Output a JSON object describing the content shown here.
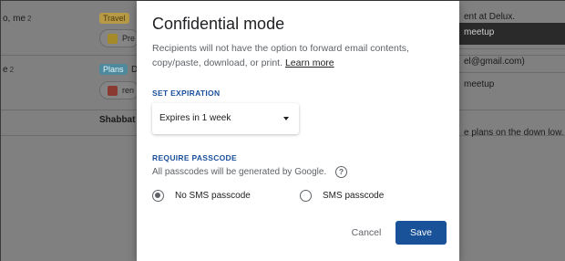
{
  "inbox": {
    "rows": [
      {
        "sender": "o, me",
        "count": "2",
        "label": "Travel",
        "attachment": "Pre"
      },
      {
        "sender": "e",
        "count": "2",
        "label": "Plans",
        "subject": "D",
        "attachment": "ren"
      },
      {
        "subject": "Shabbat"
      }
    ],
    "right_fragments": [
      "ent at Delux.",
      "meetup",
      "el@gmail.com)",
      "meetup",
      "e plans on the down low. Co"
    ]
  },
  "modal": {
    "title": "Confidential mode",
    "description": "Recipients will not have the option to forward email contents, copy/paste, download, or print.",
    "learn_more": "Learn more",
    "expiration": {
      "label": "SET EXPIRATION",
      "selected": "Expires in 1 week"
    },
    "passcode": {
      "label": "REQUIRE PASSCODE",
      "note": "All passcodes will be generated by Google.",
      "options": [
        {
          "label": "No SMS passcode",
          "checked": true
        },
        {
          "label": "SMS passcode",
          "checked": false
        }
      ]
    },
    "cancel_label": "Cancel",
    "save_label": "Save"
  },
  "colors": {
    "accent": "#1a5299",
    "section_label": "#1a4f9c",
    "overlay": "#808080"
  },
  "icons": [
    "caret-down-icon",
    "help-icon",
    "radio-icon"
  ]
}
